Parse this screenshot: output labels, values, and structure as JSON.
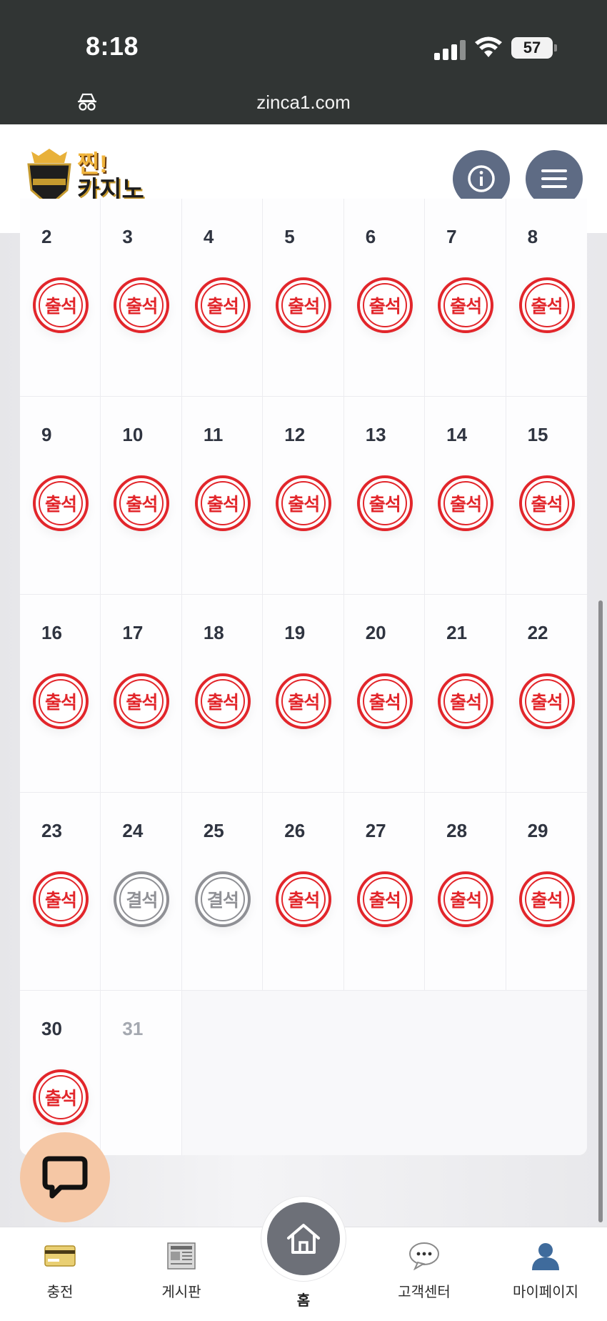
{
  "status_bar": {
    "time": "8:18",
    "battery": "57"
  },
  "browser": {
    "url": "zinca1.com"
  },
  "header": {
    "logo_top": "찐!",
    "logo_bottom": "카지노"
  },
  "calendar": {
    "days": [
      {
        "num": "2",
        "stamp": "출석",
        "status": "present"
      },
      {
        "num": "3",
        "stamp": "출석",
        "status": "present"
      },
      {
        "num": "4",
        "stamp": "출석",
        "status": "present"
      },
      {
        "num": "5",
        "stamp": "출석",
        "status": "present"
      },
      {
        "num": "6",
        "stamp": "출석",
        "status": "present"
      },
      {
        "num": "7",
        "stamp": "출석",
        "status": "present"
      },
      {
        "num": "8",
        "stamp": "출석",
        "status": "present"
      },
      {
        "num": "9",
        "stamp": "출석",
        "status": "present"
      },
      {
        "num": "10",
        "stamp": "출석",
        "status": "present"
      },
      {
        "num": "11",
        "stamp": "출석",
        "status": "present"
      },
      {
        "num": "12",
        "stamp": "출석",
        "status": "present"
      },
      {
        "num": "13",
        "stamp": "출석",
        "status": "present"
      },
      {
        "num": "14",
        "stamp": "출석",
        "status": "present"
      },
      {
        "num": "15",
        "stamp": "출석",
        "status": "present"
      },
      {
        "num": "16",
        "stamp": "출석",
        "status": "present"
      },
      {
        "num": "17",
        "stamp": "출석",
        "status": "present"
      },
      {
        "num": "18",
        "stamp": "출석",
        "status": "present"
      },
      {
        "num": "19",
        "stamp": "출석",
        "status": "present"
      },
      {
        "num": "20",
        "stamp": "출석",
        "status": "present"
      },
      {
        "num": "21",
        "stamp": "출석",
        "status": "present"
      },
      {
        "num": "22",
        "stamp": "출석",
        "status": "present"
      },
      {
        "num": "23",
        "stamp": "출석",
        "status": "present"
      },
      {
        "num": "24",
        "stamp": "결석",
        "status": "absent"
      },
      {
        "num": "25",
        "stamp": "결석",
        "status": "absent"
      },
      {
        "num": "26",
        "stamp": "출석",
        "status": "present"
      },
      {
        "num": "27",
        "stamp": "출석",
        "status": "present"
      },
      {
        "num": "28",
        "stamp": "출석",
        "status": "present"
      },
      {
        "num": "29",
        "stamp": "출석",
        "status": "present"
      },
      {
        "num": "30",
        "stamp": "출석",
        "status": "present"
      },
      {
        "num": "31",
        "stamp": "",
        "status": "future"
      }
    ]
  },
  "bottom_nav": {
    "charge": "충전",
    "board": "게시판",
    "home": "홈",
    "support": "고객센터",
    "mypage": "마이페이지"
  },
  "colors": {
    "present": "#e2262b",
    "absent": "#8f9095",
    "header_button": "#5e6b84",
    "chat": "#f5c7a5"
  }
}
